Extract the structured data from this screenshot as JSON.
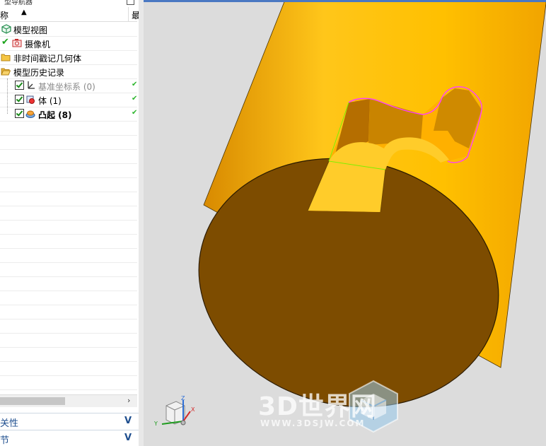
{
  "navigator": {
    "header_fragment": "型导航器",
    "column_name": "称",
    "column_latest": "最",
    "nodes": [
      {
        "label": "模型视图",
        "icon": "model-views-icon",
        "status": ""
      },
      {
        "label": "摄像机",
        "icon": "camera-icon",
        "status": ""
      },
      {
        "label": "非时间戳记几何体",
        "icon": "folder-icon",
        "status": ""
      },
      {
        "label": "模型历史记录",
        "icon": "open-folder-icon",
        "status": ""
      },
      {
        "label": "基准坐标系 (0)",
        "icon": "datum-csys-icon",
        "status": "✔"
      },
      {
        "label": "体 (1)",
        "icon": "body-feature-icon",
        "status": "✔"
      },
      {
        "label": "凸起 (8)",
        "icon": "emboss-feature-icon",
        "status": "✔"
      }
    ],
    "sections": [
      {
        "label": "关性",
        "chevron": "V"
      },
      {
        "label": "节",
        "chevron": "V"
      }
    ]
  },
  "viewport": {
    "triad": {
      "x_label": "X",
      "y_label": "Y",
      "z_label": "Z"
    },
    "watermark": {
      "title": "3D世界网",
      "url": "WWW.3DSJW.COM"
    },
    "colors": {
      "cylinder_side": "#ffbf00",
      "cylinder_end": "#7d4c00",
      "background": "#dcdcdc",
      "edge_highlight": "#ff40ff"
    }
  }
}
